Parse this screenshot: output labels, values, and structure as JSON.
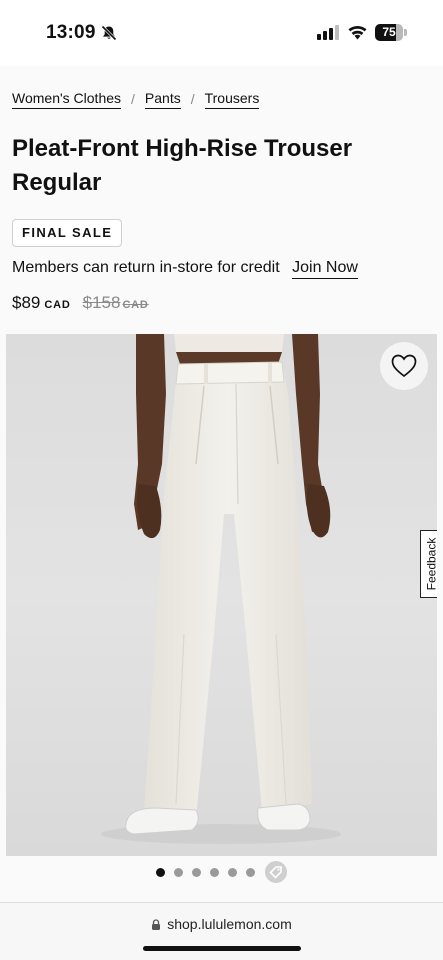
{
  "status_bar": {
    "time": "13:09",
    "battery_level": "75",
    "battery_fraction": 0.75,
    "icons": [
      "bell-slash-icon",
      "cellular-signal-icon",
      "wifi-icon",
      "battery-icon"
    ]
  },
  "breadcrumb": {
    "items": [
      "Women's Clothes",
      "Pants",
      "Trousers"
    ],
    "separator": "/"
  },
  "product": {
    "title": "Pleat-Front High-Rise Trouser Regular",
    "badge": "FINAL SALE",
    "members_text": "Members can return in-store for credit",
    "join_label": "Join Now",
    "price": "$89",
    "currency": "CAD",
    "original_price": "$158",
    "original_currency": "CAD"
  },
  "image": {
    "wishlist_icon": "heart-icon",
    "feedback_label": "Feedback",
    "background_color": "#dedede"
  },
  "carousel": {
    "dot_count": 6,
    "active_index": 0,
    "extra_icon": "tag-icon"
  },
  "browser": {
    "url": "shop.lululemon.com",
    "lock_icon": "lock-icon"
  }
}
